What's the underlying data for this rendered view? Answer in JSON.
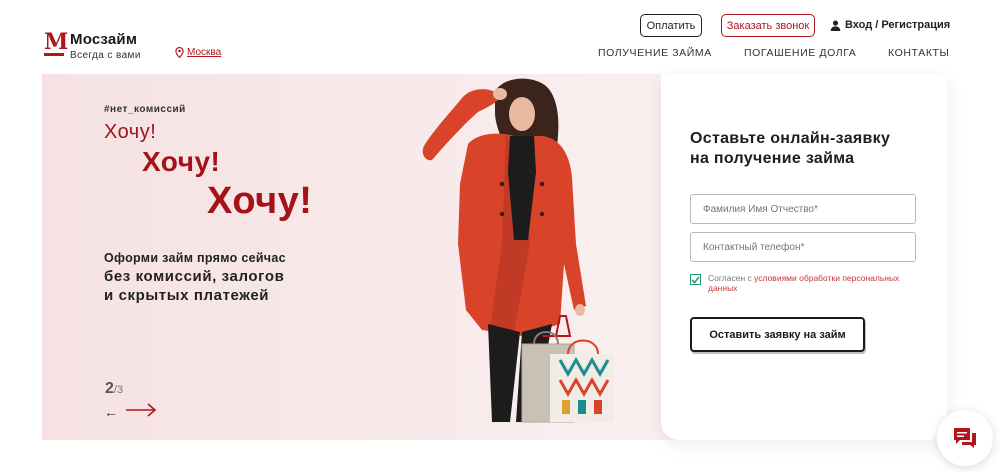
{
  "header": {
    "brand": "Мосзайм",
    "tagline": "Всегда с вами",
    "city": "Москва",
    "pay_label": "Оплатить",
    "call_label": "Заказать звонок",
    "login_label": "Вход / Регистрация",
    "nav": [
      "ПОЛУЧЕНИЕ ЗАЙМА",
      "ПОГАШЕНИЕ ДОЛГА",
      "КОНТАКТЫ"
    ]
  },
  "hero": {
    "hashtag": "#нет_комиссий",
    "want1": "Хочу!",
    "want2": "Хочу!",
    "want3": "Хочу!",
    "subtitle": "Оформи займ прямо сейчас",
    "subtitle2_line1": "без комиссий, залогов",
    "subtitle2_line2": "и скрытых платежей",
    "slide_current": "2",
    "slide_total": "/3",
    "prev_arrow": "←"
  },
  "form": {
    "title_line1": "Оставьте онлайн-заявку",
    "title_line2": "на получение займа",
    "name_placeholder": "Фамилия Имя Отчество*",
    "phone_placeholder": "Контактный телефон*",
    "consent_prefix": "Согласен с ",
    "consent_link": "условиями обработки персональных данных",
    "consent_checked": true,
    "submit_label": "Оставить заявку на займ"
  },
  "colors": {
    "accent": "#b0171d",
    "hero_bg": "#f7e6e6",
    "checkbox": "#2a9a6e"
  },
  "icons": [
    "logo-m-icon",
    "map-pin-icon",
    "user-icon",
    "arrow-right-icon",
    "check-icon",
    "chat-icon"
  ]
}
